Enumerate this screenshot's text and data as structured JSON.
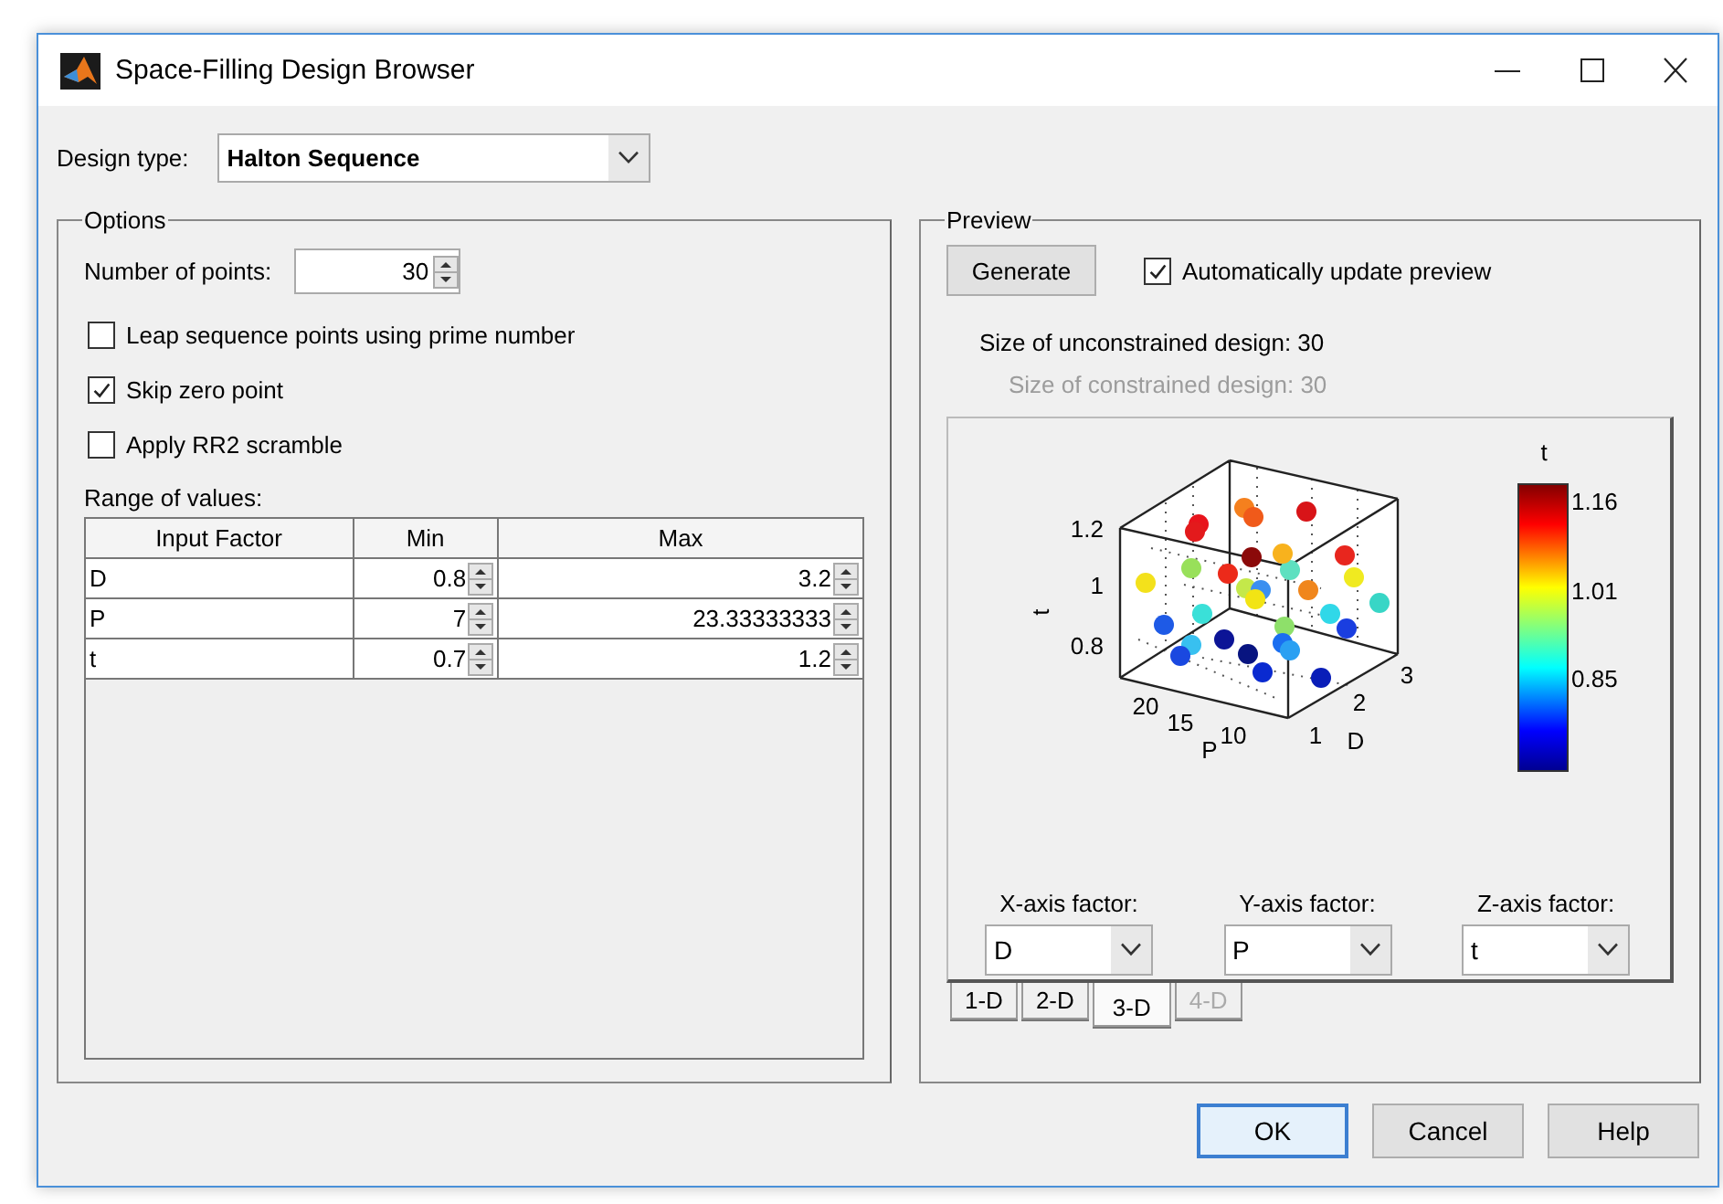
{
  "window": {
    "title": "Space-Filling Design Browser"
  },
  "design_type": {
    "label": "Design type:",
    "value": "Halton Sequence"
  },
  "options": {
    "title": "Options",
    "number_of_points": {
      "label": "Number of points:",
      "value": "30"
    },
    "checkboxes": [
      {
        "label": "Leap sequence points using prime number",
        "checked": false
      },
      {
        "label": "Skip zero point",
        "checked": true
      },
      {
        "label": "Apply RR2 scramble",
        "checked": false
      }
    ],
    "range_label": "Range of values:",
    "table": {
      "columns": [
        "Input Factor",
        "Min",
        "Max"
      ],
      "rows": [
        [
          "D",
          "0.8",
          "3.2"
        ],
        [
          "P",
          "7",
          "23.33333333"
        ],
        [
          "t",
          "0.7",
          "1.2"
        ]
      ]
    }
  },
  "preview": {
    "title": "Preview",
    "generate_button": "Generate",
    "auto_update": {
      "label": "Automatically update preview",
      "checked": true
    },
    "info": [
      {
        "text": "Size of unconstrained design:  30",
        "disabled": false
      },
      {
        "text": "Size of constrained design:  30",
        "disabled": true
      }
    ],
    "plot": {
      "z_label": "t",
      "z_ticks": [
        "1.2",
        "1",
        "0.8"
      ],
      "y_label": "P",
      "y_ticks": [
        "20",
        "15",
        "10"
      ],
      "x_label": "D",
      "x_ticks": [
        "1",
        "2",
        "3"
      ],
      "colorbar_title": "t",
      "colorbar_ticks": [
        "1.16",
        "1.01",
        "0.85"
      ]
    },
    "axis_factors": [
      {
        "label": "X-axis factor:",
        "value": "D"
      },
      {
        "label": "Y-axis factor:",
        "value": "P"
      },
      {
        "label": "Z-axis factor:",
        "value": "t"
      }
    ],
    "tabs": [
      {
        "label": "1-D",
        "selected": false,
        "disabled": false
      },
      {
        "label": "2-D",
        "selected": false,
        "disabled": false
      },
      {
        "label": "3-D",
        "selected": true,
        "disabled": false
      },
      {
        "label": "4-D",
        "selected": false,
        "disabled": true
      }
    ]
  },
  "buttons": [
    {
      "label": "OK",
      "default": true
    },
    {
      "label": "Cancel",
      "default": false
    },
    {
      "label": "Help",
      "default": false
    }
  ]
}
